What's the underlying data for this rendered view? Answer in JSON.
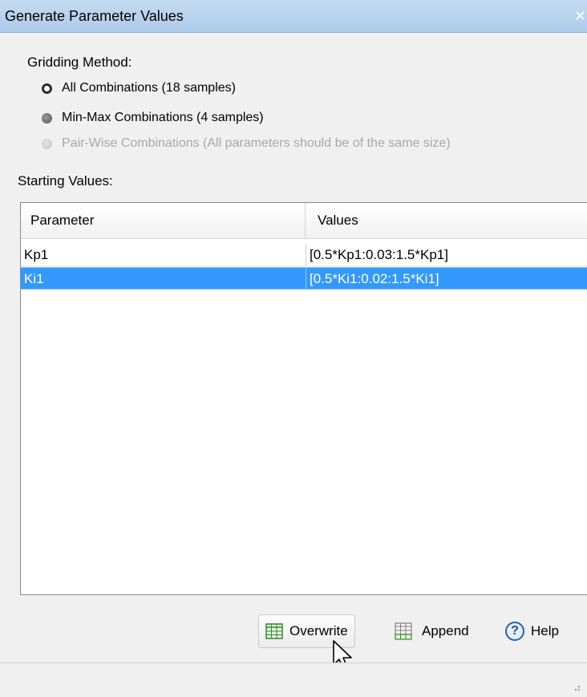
{
  "window": {
    "title": "Generate Parameter Values",
    "close_glyph": "✕"
  },
  "gridding": {
    "label": "Gridding Method:",
    "options": [
      {
        "label": "All Combinations (18 samples)",
        "state": "selected"
      },
      {
        "label": "Min-Max Combinations (4 samples)",
        "state": "unselected"
      },
      {
        "label": "Pair-Wise Combinations (All parameters should be of the same size)",
        "state": "disabled"
      }
    ]
  },
  "starting_values": {
    "label": "Starting Values:",
    "columns": [
      "Parameter",
      "Values"
    ],
    "rows": [
      {
        "parameter": "Kp1",
        "values": "[0.5*Kp1:0.03:1.5*Kp1]",
        "selected": false
      },
      {
        "parameter": "Ki1",
        "values": "[0.5*Ki1:0.02:1.5*Ki1]",
        "selected": true
      }
    ]
  },
  "buttons": {
    "overwrite": "Overwrite",
    "append": "Append",
    "help": "Help",
    "help_glyph": "?"
  },
  "icons": {
    "overwrite": "grid-table-icon",
    "append": "grid-table-add-icon",
    "help": "help-icon",
    "cursor": "mouse-pointer-icon"
  },
  "colors": {
    "selection": "#3399ff",
    "title_bar": "#b8d3ee",
    "grid_icon": "#2e8b2e"
  }
}
